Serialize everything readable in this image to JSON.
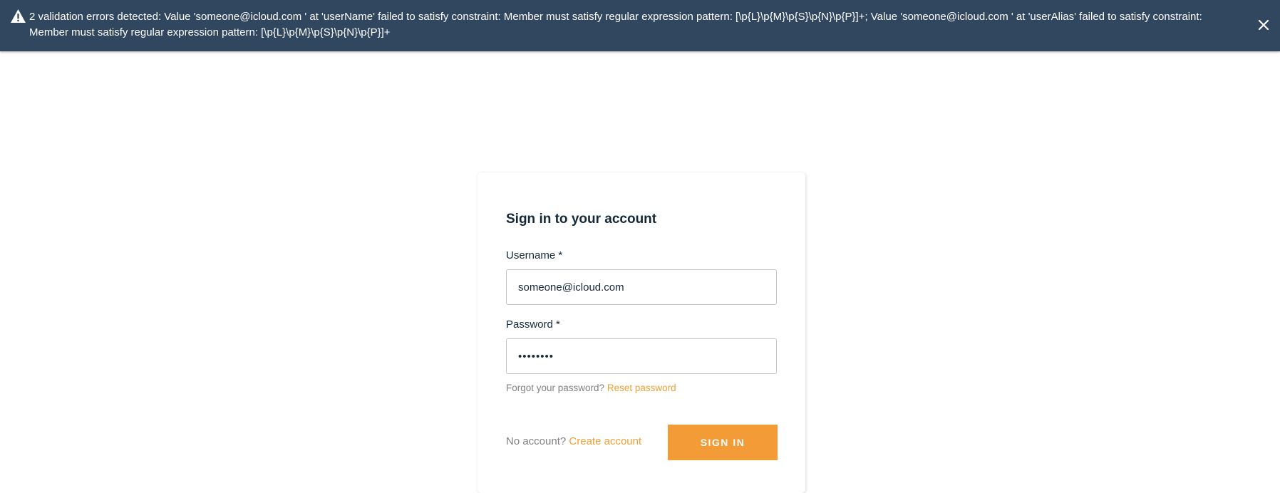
{
  "banner": {
    "message": "2 validation errors detected: Value 'someone@icloud.com ' at 'userName' failed to satisfy constraint: Member must satisfy regular expression pattern: [\\p{L}\\p{M}\\p{S}\\p{N}\\p{P}]+; Value 'someone@icloud.com ' at 'userAlias' failed to satisfy constraint: Member must satisfy regular expression pattern: [\\p{L}\\p{M}\\p{S}\\p{N}\\p{P}]+",
    "icon": "warning-icon",
    "close_icon": "close-icon",
    "background": "#31465f"
  },
  "form": {
    "title": "Sign in to your account",
    "username": {
      "label": "Username",
      "required_mark": "*",
      "value": "someone@icloud.com"
    },
    "password": {
      "label": "Password",
      "required_mark": "*",
      "value": "••••••••"
    },
    "forgot": {
      "text": "Forgot your password?",
      "link": "Reset password"
    },
    "no_account": {
      "text": "No account?",
      "link": "Create account"
    },
    "submit_label": "SIGN IN",
    "accent_color": "#f39b37"
  }
}
